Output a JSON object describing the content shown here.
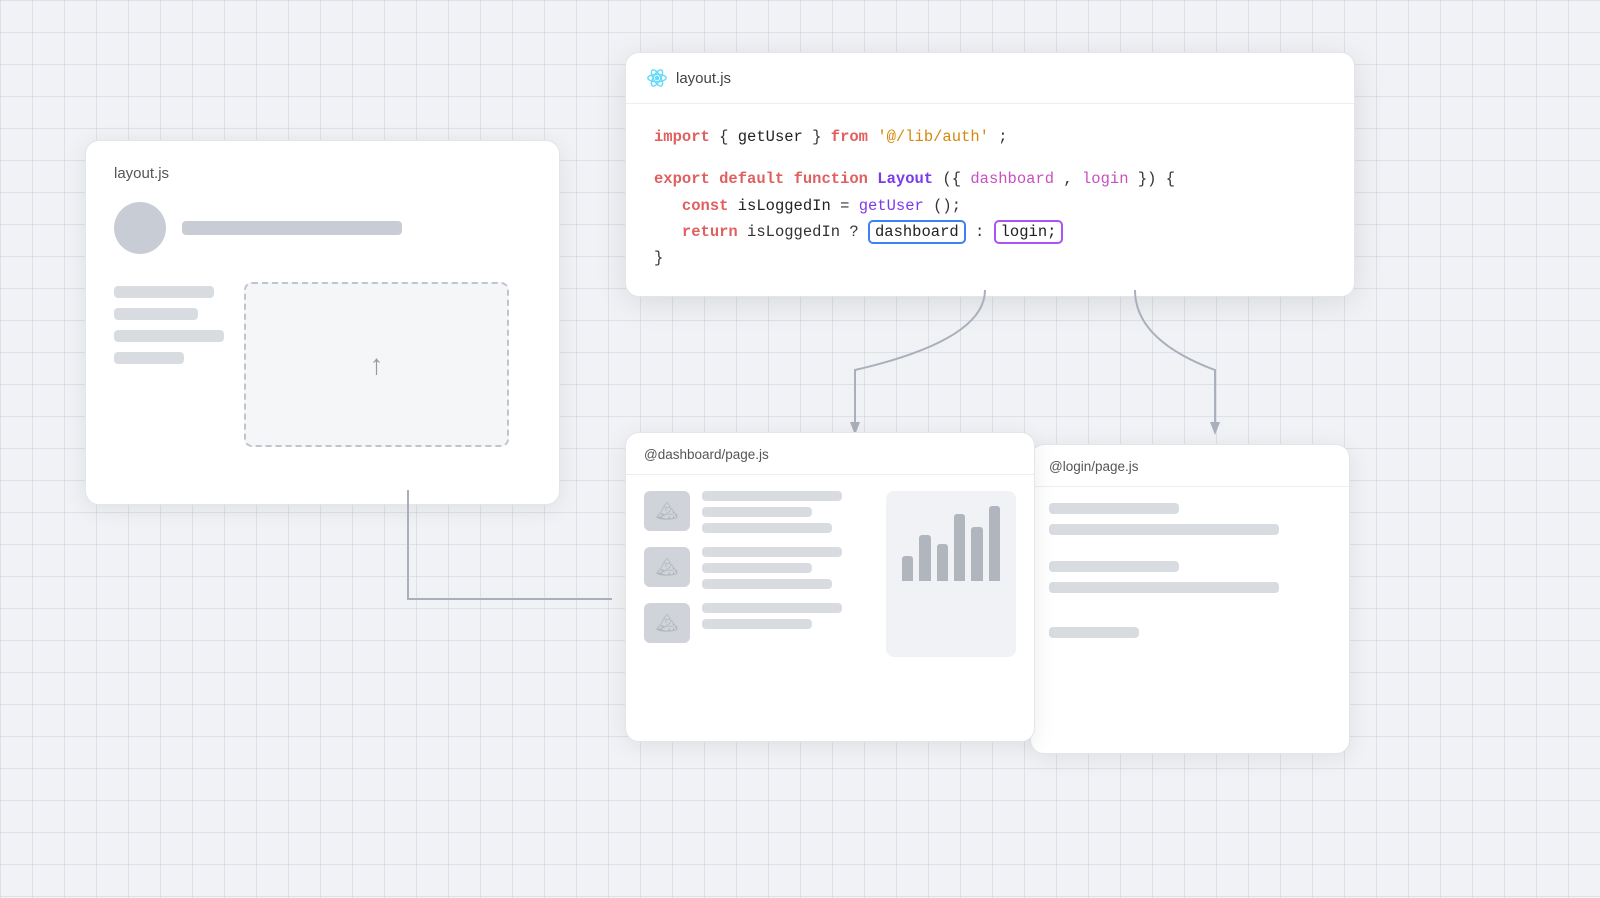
{
  "background_card": {
    "title": "layout.js"
  },
  "code_card": {
    "title": "layout.js",
    "lines": {
      "import_kw": "import",
      "brace_open": "{ ",
      "fn_get_user": "getUser",
      "brace_close": " }",
      "from_kw": "from",
      "import_path": "'@/lib/auth'",
      "semicolon": ";",
      "export_kw": "export",
      "default_kw": "default",
      "function_kw": "function",
      "layout_name": "Layout",
      "params": "({ dashboard, login })",
      "curly_open": "{",
      "const_kw": "const",
      "is_logged_in": "isLoggedIn",
      "equals": " =",
      "get_user_call": "getUser",
      "call_parens": "()",
      "return_kw": "return",
      "is_logged_in2": "isLoggedIn",
      "ternary": "?",
      "dashboard_val": "dashboard",
      "colon": ":",
      "login_val": "login;",
      "curly_close": "}"
    }
  },
  "dashboard_panel": {
    "title": "@dashboard/page.js",
    "bars": [
      30,
      55,
      45,
      80,
      65,
      90
    ]
  },
  "login_panel": {
    "title": "@login/page.js"
  },
  "arrows": {
    "left_label": "",
    "right_label": ""
  }
}
